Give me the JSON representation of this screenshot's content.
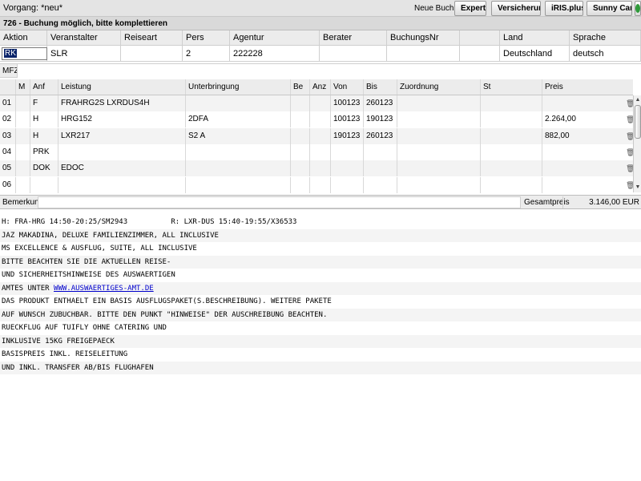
{
  "topbar": {
    "vorgang": "Vorgang: *neu*",
    "neue_buchung_label": "Neue Buchung:",
    "buttons": [
      "Expert",
      "Versicherung",
      "iRIS.plus",
      "Sunny Cars"
    ]
  },
  "status": "726 - Buchung möglich, bitte komplettieren",
  "header": {
    "labels": [
      "Aktion",
      "Veranstalter",
      "Reiseart",
      "Pers",
      "Agentur",
      "Berater",
      "BuchungsNr",
      "",
      "Land",
      "Sprache"
    ],
    "values": {
      "aktion": "RK",
      "veranstalter": "SLR",
      "reiseart": "",
      "pers": "2",
      "agentur": "222228",
      "berater": "",
      "buchungsnr": "",
      "blank": "",
      "land": "Deutschland",
      "sprache": "deutsch"
    }
  },
  "mfz_label": "MFZ",
  "grid": {
    "columns": [
      "",
      "M",
      "Anf",
      "Leistung",
      "Unterbringung",
      "Be",
      "Anz",
      "Von",
      "Bis",
      "Zuordnung",
      "St",
      "Preis"
    ],
    "rows": [
      {
        "nr": "01",
        "m": "",
        "anf": "F",
        "leistung": "FRAHRG2S LXRDUS4H",
        "unterbringung": "",
        "be": "",
        "anz": "",
        "von": "100123",
        "bis": "260123",
        "zuordnung": "",
        "st": "",
        "preis": ""
      },
      {
        "nr": "02",
        "m": "",
        "anf": "H",
        "leistung": "HRG152",
        "unterbringung": "2DFA",
        "be": "",
        "anz": "",
        "von": "100123",
        "bis": "190123",
        "zuordnung": "",
        "st": "",
        "preis": "2.264,00"
      },
      {
        "nr": "03",
        "m": "",
        "anf": "H",
        "leistung": "LXR217",
        "unterbringung": "S2 A",
        "be": "",
        "anz": "",
        "von": "190123",
        "bis": "260123",
        "zuordnung": "",
        "st": "",
        "preis": "882,00"
      },
      {
        "nr": "04",
        "m": "",
        "anf": "PRK",
        "leistung": "",
        "unterbringung": "",
        "be": "",
        "anz": "",
        "von": "",
        "bis": "",
        "zuordnung": "",
        "st": "",
        "preis": ""
      },
      {
        "nr": "05",
        "m": "",
        "anf": "DOK",
        "leistung": "EDOC",
        "unterbringung": "",
        "be": "",
        "anz": "",
        "von": "",
        "bis": "",
        "zuordnung": "",
        "st": "",
        "preis": ""
      },
      {
        "nr": "06",
        "m": "",
        "anf": "",
        "leistung": "",
        "unterbringung": "",
        "be": "",
        "anz": "",
        "von": "",
        "bis": "",
        "zuordnung": "",
        "st": "",
        "preis": ""
      }
    ]
  },
  "bemerkung_label": "Bemerkung",
  "gesamtpreis_label": "Gesamtpreis",
  "gesamtpreis_value": "3.146,00 EUR",
  "text_lines": [
    "H: FRA-HRG 14:50-20:25/SM2943          R: LXR-DUS 15:40-19:55/X36533",
    "JAZ MAKADINA, DELUXE FAMILIENZIMMER, ALL INCLUSIVE",
    "MS EXCELLENCE & AUSFLUG, SUITE, ALL INCLUSIVE",
    "BITTE BEACHTEN SIE DIE AKTUELLEN REISE-",
    "UND SICHERHEITSHINWEISE DES AUSWAERTIGEN",
    "AMTES UNTER ",
    "DAS PRODUKT ENTHAELT EIN BASIS AUSFLUGSPAKET(S.BESCHREIBUNG). WEITERE PAKETE",
    "AUF WUNSCH ZUBUCHBAR. BITTE DEN PUNKT \"HINWEISE\" DER AUSCHREIBUNG BEACHTEN.",
    "RUECKFLUG AUF TUIFLY OHNE CATERING UND",
    "INKLUSIVE 15KG FREIGEPAECK",
    "BASISPREIS INKL. REISELEITUNG",
    "UND INKL. TRANSFER AB/BIS FLUGHAFEN"
  ],
  "link_text": "WWW.AUSWAERTIGES-AMT.DE",
  "colors": {
    "expert": "#d9302c",
    "versicherung": "#f2c230",
    "iris": "#1a4fa0",
    "sunny": "#2f9a3a"
  }
}
